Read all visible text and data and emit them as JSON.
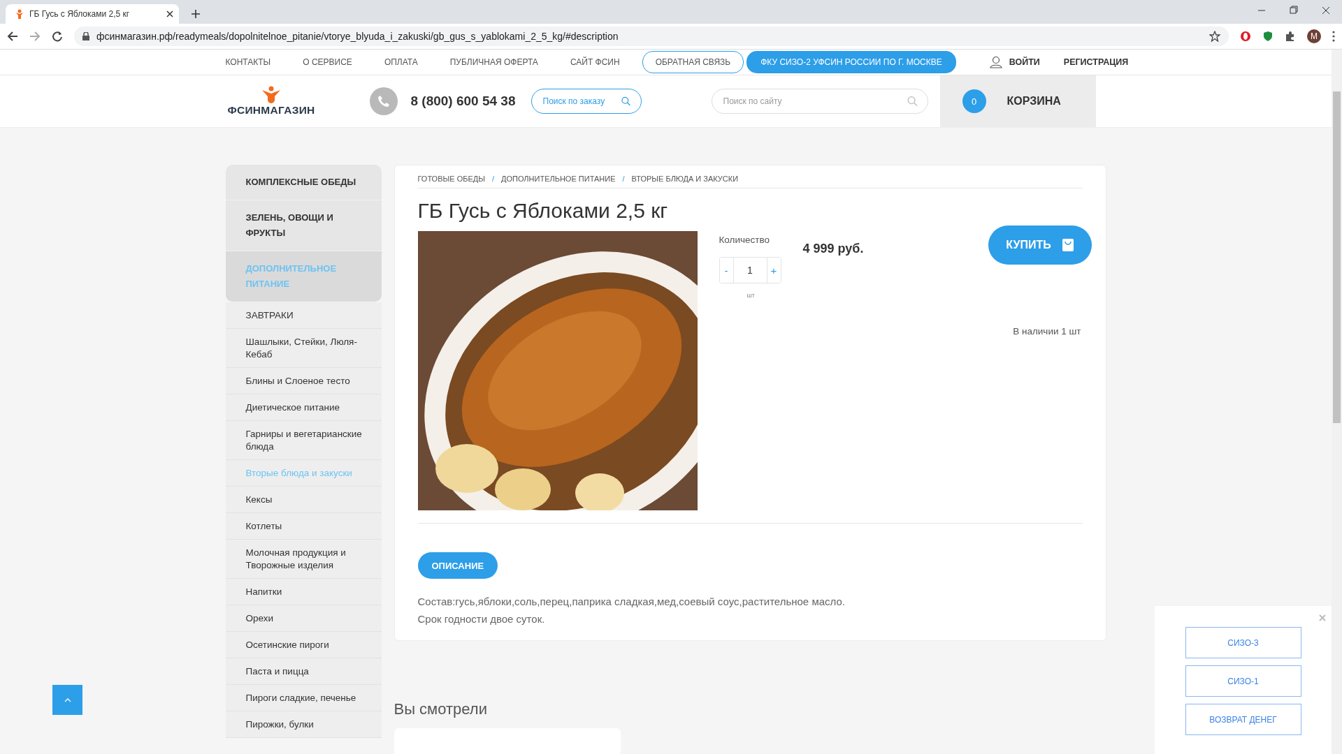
{
  "browser": {
    "tab_title": "ГБ Гусь с Яблоками 2,5 кг",
    "url": "фсинмагазин.рф/readymeals/dopolnitelnoe_pitanie/vtorye_blyuda_i_zakuski/gb_gus_s_yablokami_2_5_kg/#description",
    "profile_initial": "M"
  },
  "top_nav": {
    "links": [
      {
        "label": "КОНТАКТЫ",
        "kind": "link"
      },
      {
        "label": "О СЕРВИСЕ",
        "kind": "link"
      },
      {
        "label": "ОПЛАТА",
        "kind": "link"
      },
      {
        "label": "ПУБЛИЧНАЯ ОФЕРТА",
        "kind": "link"
      },
      {
        "label": "САЙТ ФСИН",
        "kind": "link"
      },
      {
        "label": "ОБРАТНАЯ СВЯЗЬ",
        "kind": "outline"
      },
      {
        "label": "ФКУ СИЗО-2 УФСИН РОССИИ ПО Г. МОСКВЕ",
        "kind": "filled"
      }
    ],
    "login": "ВОЙТИ",
    "register": "РЕГИСТРАЦИЯ"
  },
  "header": {
    "logo": "ФСИНМАГАЗИН",
    "phone": "8 (800) 600 54 38",
    "order_search": {
      "placeholder": "Поиск по заказу"
    },
    "site_search": {
      "placeholder": "Поиск по сайту"
    },
    "cart": {
      "count": "0",
      "label": "КОРЗИНА"
    }
  },
  "sidebar": {
    "items": [
      {
        "label": "КОМПЛЕКСНЫЕ ОБЕДЫ",
        "kind": "category",
        "selected": false
      },
      {
        "label": "ЗЕЛЕНЬ, ОВОЩИ И ФРУКТЫ",
        "kind": "category",
        "selected": false
      },
      {
        "label": "ДОПОЛНИТЕЛЬНОЕ ПИТАНИЕ",
        "kind": "category",
        "selected": true
      },
      {
        "label": "ЗАВТРАКИ",
        "kind": "subcategory",
        "selected": false
      },
      {
        "label": "Шашлыки, Стейки, Люля-Кебаб",
        "kind": "subcategory",
        "selected": false
      },
      {
        "label": "Блины и Слоеное тесто",
        "kind": "subcategory",
        "selected": false
      },
      {
        "label": "Диетическое питание",
        "kind": "subcategory",
        "selected": false
      },
      {
        "label": "Гарниры и вегетарианские блюда",
        "kind": "subcategory",
        "selected": false
      },
      {
        "label": "Вторые блюда и закуски",
        "kind": "subcategory",
        "selected": true
      },
      {
        "label": "Кексы",
        "kind": "subcategory",
        "selected": false
      },
      {
        "label": "Котлеты",
        "kind": "subcategory",
        "selected": false
      },
      {
        "label": "Молочная продукция и Творожные изделия",
        "kind": "subcategory",
        "selected": false
      },
      {
        "label": "Напитки",
        "kind": "subcategory",
        "selected": false
      },
      {
        "label": "Орехи",
        "kind": "subcategory",
        "selected": false
      },
      {
        "label": "Осетинские пироги",
        "kind": "subcategory",
        "selected": false
      },
      {
        "label": "Паста и пицца",
        "kind": "subcategory",
        "selected": false
      },
      {
        "label": "Пироги сладкие, печенье",
        "kind": "subcategory",
        "selected": false
      },
      {
        "label": "Пирожки, булки",
        "kind": "subcategory",
        "selected": false
      }
    ]
  },
  "product": {
    "breadcrumbs": [
      "ГОТОВЫЕ ОБЕДЫ",
      "ДОПОЛНИТЕЛЬНОЕ ПИТАНИЕ",
      "ВТОРЫЕ БЛЮДА И ЗАКУСКИ"
    ],
    "breadcrumb_separators": [
      "/",
      "/"
    ],
    "title": "ГБ Гусь с Яблоками 2,5 кг",
    "quantity_label": "Количество",
    "decrement": "-",
    "quantity": "1",
    "increment": "+",
    "unit": "шт",
    "price": "4 999 руб.",
    "buy_button": "КУПИТЬ",
    "stock": "В наличии 1 шт",
    "tabs": [
      {
        "label": "ОПИСАНИЕ",
        "selected": true
      }
    ],
    "description": [
      "Состав:гусь,яблоки,соль,перец,паприка сладкая,мед,соевый соус,растительное масло.",
      "Срок годности двое суток."
    ]
  },
  "recent": {
    "title": "Вы смотрели"
  },
  "popup": {
    "buttons": [
      "СИЗО-3",
      "СИЗО-1",
      "ВОЗВРАТ ДЕНЕГ"
    ]
  }
}
